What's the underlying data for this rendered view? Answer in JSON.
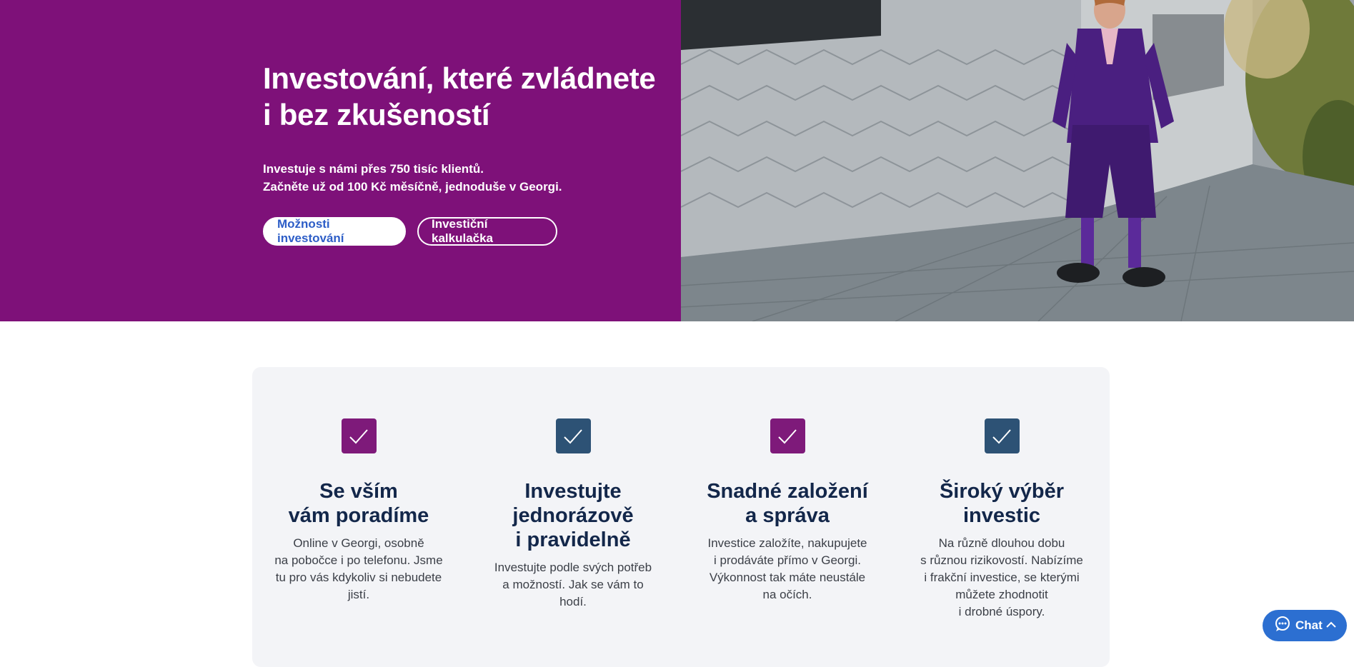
{
  "hero": {
    "title_line1": "Investování, které zvládnete",
    "title_line2": "i bez zkušeností",
    "sub_line1": "Investuje s námi přes 750 tisíc klientů.",
    "sub_line2": "Začněte už od 100 Kč měsíčně, jednoduše v Georgi.",
    "primary_button": "Možnosti investování",
    "secondary_button": "Investiční kalkulačka",
    "background_color": "#7e1179"
  },
  "features": [
    {
      "icon": "checkmark-icon",
      "icon_color": "#7e1a7a",
      "title_lines": [
        "Se vším",
        "vám poradíme"
      ],
      "text_lines": [
        "Online v Georgi, osobně",
        "na pobočce i po telefonu. Jsme",
        "tu pro vás kdykoliv si nebudete",
        "jistí."
      ]
    },
    {
      "icon": "checkmark-icon",
      "icon_color": "#2d5275",
      "title_lines": [
        "Investujte",
        "jednorázově",
        "i pravidelně"
      ],
      "text_lines": [
        "Investujte podle svých potřeb",
        "a možností. Jak se vám to",
        "hodí."
      ]
    },
    {
      "icon": "checkmark-icon",
      "icon_color": "#7e1a7a",
      "title_lines": [
        "Snadné založení",
        "a správa"
      ],
      "text_lines": [
        "Investice založíte, nakupujete",
        "i prodáváte přímo v Georgi.",
        "Výkonnost tak máte neustále",
        "na očích."
      ]
    },
    {
      "icon": "checkmark-icon",
      "icon_color": "#2d5275",
      "title_lines": [
        "Široký výběr",
        "investic"
      ],
      "text_lines": [
        "Na různě dlouhou dobu",
        "s různou rizikovostí. Nabízíme",
        "i frakční investice, se kterými",
        "můžete zhodnotit",
        "i drobné úspory."
      ]
    }
  ],
  "chat": {
    "label": "Chat",
    "icon": "chat-bubble-icon",
    "chevron": "chevron-up-icon",
    "color": "#2c6fd1"
  }
}
